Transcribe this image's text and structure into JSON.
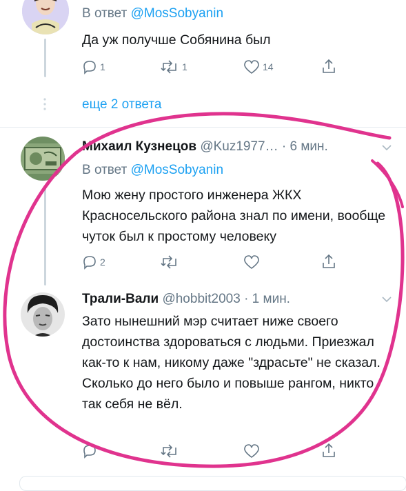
{
  "tweet_top": {
    "reply_prefix": "В ответ",
    "reply_handle": "@MosSobyanin",
    "text": "Да уж получше Собянина был",
    "replies": "1",
    "retweets": "1",
    "likes": "14"
  },
  "more_replies": "еще 2 ответа",
  "tweet_1": {
    "name": "Михаил Кузнецов",
    "handle": "@Kuz1977…",
    "time": "· 6 мин.",
    "reply_prefix": "В ответ",
    "reply_handle": "@MosSobyanin",
    "text": "Мою жену простого инженера ЖКХ Красносельского района знал по имени, вообще чуток был к простому человеку",
    "replies": "2"
  },
  "tweet_2": {
    "name": "Трали-Вали",
    "handle": "@hobbit2003",
    "time": "· 1 мин.",
    "text": "Зато нынешний мэр считает ниже своего достоинства здороваться с людьми. Приезжал как-то к нам, никому даже \"здрасьте\" не сказал. Сколько до него было и повыше рангом, никто так себя не вёл."
  },
  "colors": {
    "accent": "#1da1f2",
    "muted": "#657786",
    "annotation": "#e0338e"
  }
}
